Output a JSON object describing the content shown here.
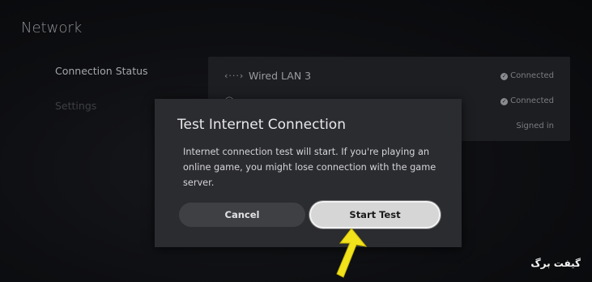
{
  "header": {
    "title": "Network"
  },
  "sidebar": {
    "items": [
      {
        "label": "Connection Status"
      },
      {
        "label": "Settings"
      }
    ]
  },
  "status_panel": {
    "rows": [
      {
        "icon": "wired-lan-icon",
        "label": "Wired LAN 3",
        "status": "Connected"
      },
      {
        "icon": "globe-icon",
        "label": "",
        "status": "Connected"
      },
      {
        "icon": "",
        "label": "",
        "status": "Signed in"
      }
    ]
  },
  "dialog": {
    "title": "Test Internet Connection",
    "body": "Internet connection test will start. If you're playing an online game, you might lose connection with the game server.",
    "cancel_label": "Cancel",
    "start_label": "Start Test"
  },
  "overlay": {
    "arrow_icon": "pointer-arrow-icon",
    "arrow_color": "#f2e21c",
    "watermark": "گیفت برگ"
  }
}
